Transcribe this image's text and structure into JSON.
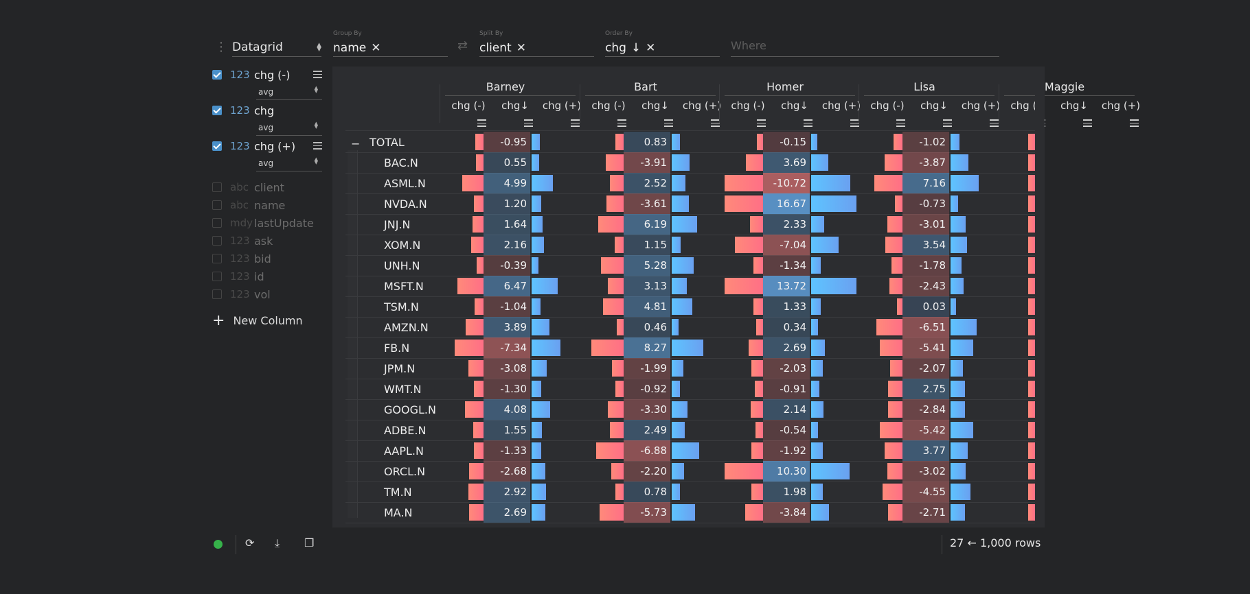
{
  "toolbar": {
    "plugin": "Datagrid",
    "group_by": {
      "label": "Group By",
      "value": "name"
    },
    "split_by": {
      "label": "Split By",
      "value": "client"
    },
    "order_by": {
      "label": "Order By",
      "value": "chg",
      "arrow": "↓"
    },
    "where_placeholder": "Where"
  },
  "columns_active": [
    {
      "type": "123",
      "name": "chg (-)",
      "agg": "avg"
    },
    {
      "type": "123",
      "name": "chg",
      "agg": "avg"
    },
    {
      "type": "123",
      "name": "chg (+)",
      "agg": "avg"
    }
  ],
  "columns_inactive": [
    {
      "type": "abc",
      "name": "client"
    },
    {
      "type": "abc",
      "name": "name"
    },
    {
      "type": "mdy",
      "name": "lastUpdate"
    },
    {
      "type": "123",
      "name": "ask"
    },
    {
      "type": "123",
      "name": "bid"
    },
    {
      "type": "123",
      "name": "id"
    },
    {
      "type": "123",
      "name": "vol"
    }
  ],
  "new_column_label": "New Column",
  "grid": {
    "groups": [
      "Barney",
      "Bart",
      "Homer",
      "Lisa",
      "Maggie"
    ],
    "subcolumns": [
      "chg (-)",
      "chg↓",
      "chg (+)"
    ],
    "rows": [
      {
        "name": "TOTAL",
        "values": [
          "-0.95",
          "0.83",
          "-0.15",
          "-1.02"
        ]
      },
      {
        "name": "BAC.N",
        "values": [
          "0.55",
          "-3.91",
          "3.69",
          "-3.87"
        ]
      },
      {
        "name": "ASML.N",
        "values": [
          "4.99",
          "2.52",
          "-10.72",
          "7.16"
        ]
      },
      {
        "name": "NVDA.N",
        "values": [
          "1.20",
          "-3.61",
          "16.67",
          "-0.73"
        ]
      },
      {
        "name": "JNJ.N",
        "values": [
          "1.64",
          "6.19",
          "2.33",
          "-3.01"
        ]
      },
      {
        "name": "XOM.N",
        "values": [
          "2.16",
          "1.15",
          "-7.04",
          "3.54"
        ]
      },
      {
        "name": "UNH.N",
        "values": [
          "-0.39",
          "5.28",
          "-1.34",
          "-1.78"
        ]
      },
      {
        "name": "MSFT.N",
        "values": [
          "6.47",
          "3.13",
          "13.72",
          "-2.43"
        ]
      },
      {
        "name": "TSM.N",
        "values": [
          "-1.04",
          "4.81",
          "1.33",
          "0.03"
        ]
      },
      {
        "name": "AMZN.N",
        "values": [
          "3.89",
          "0.46",
          "0.34",
          "-6.51"
        ]
      },
      {
        "name": "FB.N",
        "values": [
          "-7.34",
          "8.27",
          "2.69",
          "-5.41"
        ]
      },
      {
        "name": "JPM.N",
        "values": [
          "-3.08",
          "-1.99",
          "-2.03",
          "-2.07"
        ]
      },
      {
        "name": "WMT.N",
        "values": [
          "-1.30",
          "-0.92",
          "-0.91",
          "2.75"
        ]
      },
      {
        "name": "GOOGL.N",
        "values": [
          "4.08",
          "-3.30",
          "2.14",
          "-2.84"
        ]
      },
      {
        "name": "ADBE.N",
        "values": [
          "1.55",
          "2.49",
          "-0.54",
          "-5.42"
        ]
      },
      {
        "name": "AAPL.N",
        "values": [
          "-1.33",
          "-6.88",
          "-1.92",
          "3.77"
        ]
      },
      {
        "name": "ORCL.N",
        "values": [
          "-2.68",
          "-2.20",
          "10.30",
          "-3.02"
        ]
      },
      {
        "name": "TM.N",
        "values": [
          "2.92",
          "0.78",
          "1.98",
          "-4.55"
        ]
      },
      {
        "name": "MA.N",
        "values": [
          "2.69",
          "-5.73",
          "-3.84",
          "-2.71"
        ]
      }
    ]
  },
  "status": {
    "row_count": "27",
    "arrow": "←",
    "total_rows": "1,000 rows"
  },
  "colors": {
    "negative": "#ff7f80",
    "positive": "#68b4f8",
    "status_ok": "#36b24a"
  }
}
